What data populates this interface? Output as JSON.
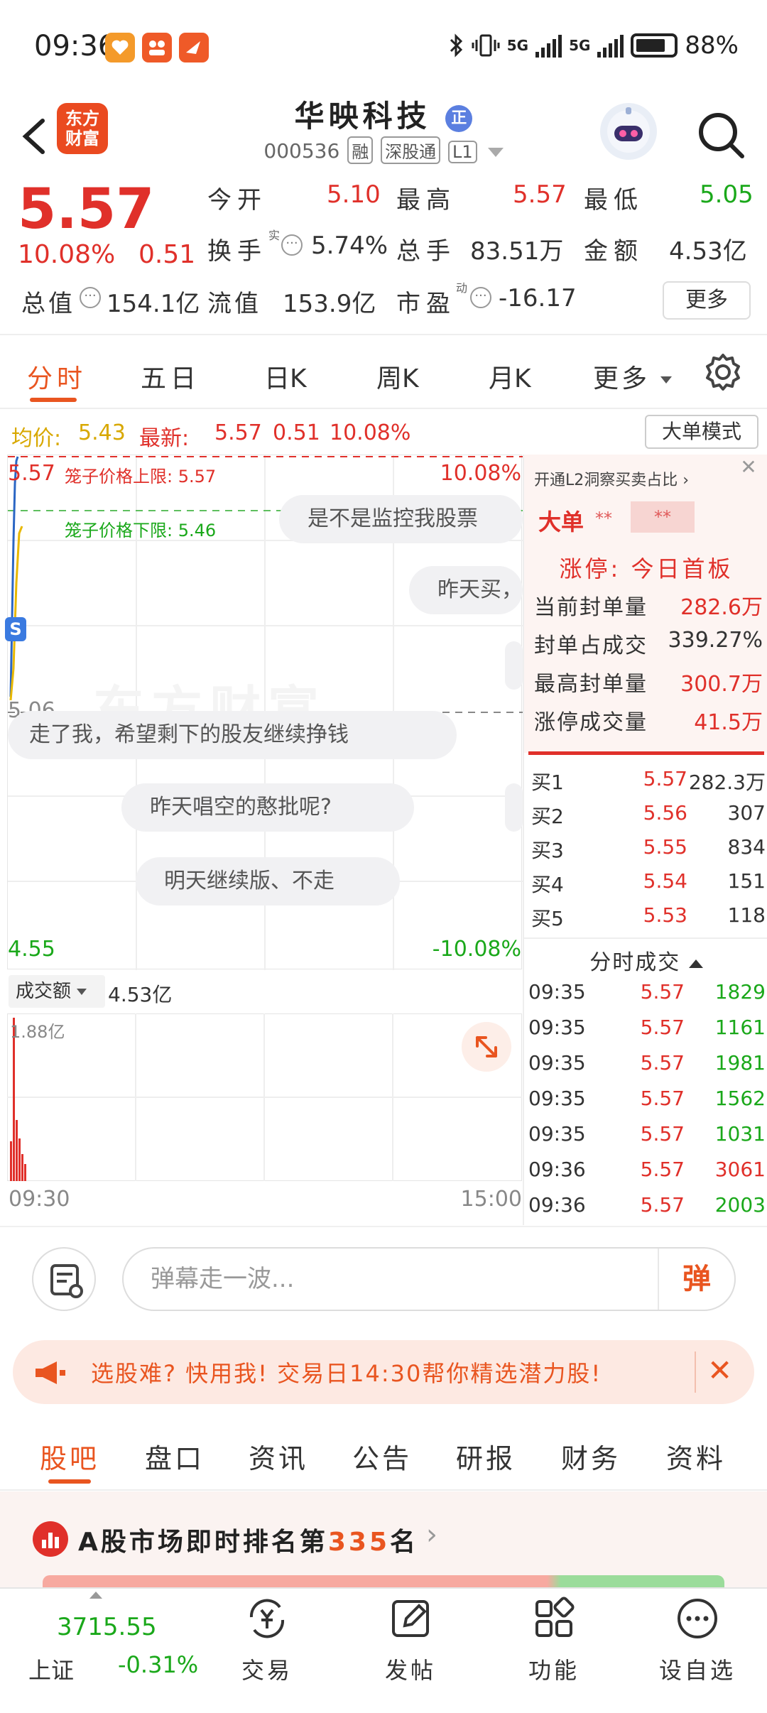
{
  "status_bar": {
    "time": "09:36",
    "network1": "5G",
    "network2": "5G",
    "battery": "88%"
  },
  "header": {
    "logo_line1": "东方",
    "logo_line2": "财富",
    "stock_name": "华映科技",
    "badge": "正",
    "stock_code": "000536",
    "tags": [
      "融",
      "深股通",
      "L1"
    ]
  },
  "quote": {
    "price": "5.57",
    "change_pct": "10.08%",
    "change": "0.51",
    "open_label": "今开",
    "open_value": "5.10",
    "high_label": "最高",
    "high_value": "5.57",
    "low_label": "最低",
    "low_value": "5.05",
    "turnover_label": "换手",
    "turnover_sup": "实",
    "turnover_value": "5.74%",
    "volume_label": "总手",
    "volume_value": "83.51万",
    "amount_label": "金额",
    "amount_value": "4.53亿",
    "total_cap_label": "总值",
    "total_cap_value": "154.1亿",
    "float_cap_label": "流值",
    "float_cap_value": "153.9亿",
    "pe_label": "市盈",
    "pe_sup": "动",
    "pe_value": "-16.17",
    "more_button": "更多"
  },
  "chart_tabs": [
    "分时",
    "五日",
    "日K",
    "周K",
    "月K",
    "更多"
  ],
  "info_line": {
    "avg_label": "均价:",
    "avg_value": "5.43",
    "latest_label": "最新:",
    "latest_value": "5.57",
    "change": "0.51",
    "change_pct": "10.08%",
    "big_order_button": "大单模式"
  },
  "main_chart": {
    "top_price": "5.57",
    "top_pct": "10.08%",
    "upper_limit": "笼子价格上限: 5.57",
    "lower_limit": "笼子价格下限: 5.46",
    "mid_price": "5.06",
    "bottom_price": "4.55",
    "bottom_pct": "-10.08%",
    "watermark": "东方财富",
    "s_marker": "S"
  },
  "danmaku": [
    "是不是监控我股票",
    "昨天买，",
    "走了我，希望剩下的股友继续挣钱",
    "昨天唱空的憨批呢?",
    "明天继续版、不走"
  ],
  "volume_chart": {
    "selector_label": "成交额",
    "amount": "4.53亿",
    "max_label": "1.88亿",
    "start_time": "09:30",
    "end_time": "15:00"
  },
  "right_panel": {
    "l2_link": "开通L2洞察买卖占比",
    "big_order_label": "大单",
    "masked1": "**",
    "masked2": "**",
    "limit_up_title": "涨停: 今日首板",
    "stats": [
      {
        "label": "当前封单量",
        "value": "282.6万"
      },
      {
        "label": "封单占成交",
        "value": "339.27%"
      },
      {
        "label": "最高封单量",
        "value": "300.7万"
      },
      {
        "label": "涨停成交量",
        "value": "41.5万"
      }
    ],
    "bids": [
      {
        "label": "买1",
        "price": "5.57",
        "vol": "282.3万"
      },
      {
        "label": "买2",
        "price": "5.56",
        "vol": "307"
      },
      {
        "label": "买3",
        "price": "5.55",
        "vol": "834"
      },
      {
        "label": "买4",
        "price": "5.54",
        "vol": "151"
      },
      {
        "label": "买5",
        "price": "5.53",
        "vol": "118"
      }
    ],
    "trades_title": "分时成交",
    "trades": [
      {
        "time": "09:35",
        "price": "5.57",
        "vol": "1829"
      },
      {
        "time": "09:35",
        "price": "5.57",
        "vol": "1161"
      },
      {
        "time": "09:35",
        "price": "5.57",
        "vol": "1981"
      },
      {
        "time": "09:35",
        "price": "5.57",
        "vol": "1562"
      },
      {
        "time": "09:35",
        "price": "5.57",
        "vol": "1031"
      },
      {
        "time": "09:36",
        "price": "5.57",
        "vol": "3061"
      },
      {
        "time": "09:36",
        "price": "5.57",
        "vol": "2003"
      }
    ]
  },
  "input_row": {
    "placeholder": "弹幕走一波...",
    "danmaku_button": "弹"
  },
  "banner": {
    "text": "选股难? 快用我! 交易日14:30帮你精选潜力股!"
  },
  "bottom_tabs": [
    "股吧",
    "盘口",
    "资讯",
    "公告",
    "研报",
    "财务",
    "资料"
  ],
  "ranking": {
    "prefix": "A股市场即时排名第",
    "rank": "335",
    "suffix": "名"
  },
  "bottom_nav": {
    "index_value": "3715.55",
    "index_name": "上证",
    "index_change": "-0.31%",
    "items": [
      "交易",
      "发帖",
      "功能",
      "设自选"
    ]
  },
  "colors": {
    "up": "#e0302a",
    "down": "#1aa81a",
    "accent": "#e95520",
    "avg_line": "#d8a800"
  }
}
